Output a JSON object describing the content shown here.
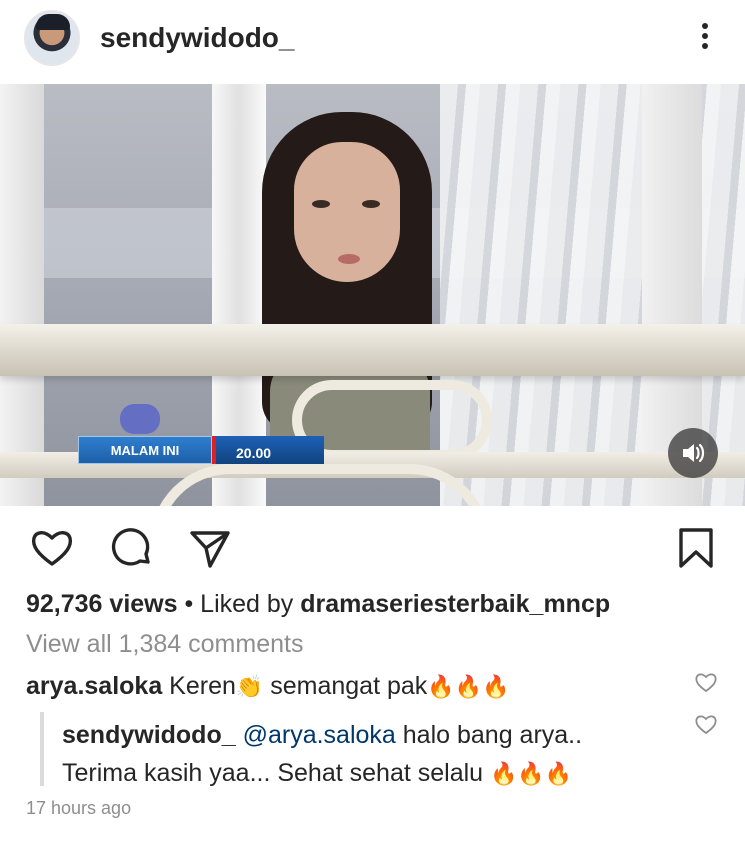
{
  "post": {
    "username": "sendywidodo_",
    "views": "92,736 views",
    "liked_prefix": "• Liked by ",
    "liked_by": "dramaseriesterbaik_mncp",
    "view_all": "View all 1,384 comments",
    "timestamp": "17 hours ago"
  },
  "media": {
    "ticker_label": "MALAM INI",
    "ticker_time": "20.00"
  },
  "comments": [
    {
      "user": "arya.saloka",
      "text_a": "Keren",
      "emoji_a": "👏",
      "text_b": " semangat pak",
      "emoji_b": "🔥🔥🔥"
    },
    {
      "user": "sendywidodo_",
      "mention": "@arya.saloka",
      "text_a": " halo bang arya..",
      "text_b": "Terima kasih yaa... Sehat sehat selalu ",
      "emoji_b": "🔥🔥🔥"
    }
  ],
  "icons": [
    "more-icon",
    "volume-icon",
    "heart-icon",
    "comment-icon",
    "share-icon",
    "bookmark-icon"
  ],
  "colors": {
    "text": "#262626",
    "muted": "#8e8e8e",
    "mention": "#00376b"
  }
}
